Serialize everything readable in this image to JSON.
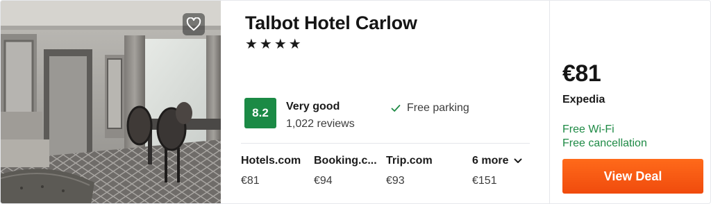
{
  "hotel": {
    "name": "Talbot Hotel Carlow",
    "stars": "★★★★"
  },
  "rating": {
    "score": "8.2",
    "label": "Very good",
    "reviews": "1,022 reviews",
    "badge_color": "#1b8a45"
  },
  "amenity": {
    "label": "Free parking",
    "icon": "check-icon"
  },
  "providers": [
    {
      "name": "Hotels.com",
      "price": "€81"
    },
    {
      "name": "Booking.c...",
      "price": "€94"
    },
    {
      "name": "Trip.com",
      "price": "€93"
    },
    {
      "name": "6 more",
      "price": "€151"
    }
  ],
  "deal": {
    "price": "€81",
    "provider": "Expedia",
    "perks": [
      "Free Wi-Fi",
      "Free cancellation"
    ],
    "button_label": "View Deal",
    "button_color": "#f4560f",
    "perk_color": "#1e8a45"
  },
  "icons": {
    "favorite": "heart-icon",
    "more": "chevron-down-icon",
    "check": "check-icon"
  }
}
